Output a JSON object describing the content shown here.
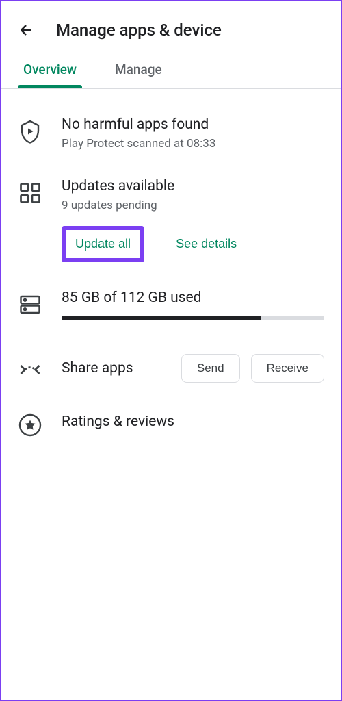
{
  "header": {
    "title": "Manage apps & device"
  },
  "tabs": {
    "overview": "Overview",
    "manage": "Manage"
  },
  "protect": {
    "title": "No harmful apps found",
    "subtitle": "Play Protect scanned at 08:33"
  },
  "updates": {
    "title": "Updates available",
    "subtitle": "9 updates pending",
    "update_all": "Update all",
    "see_details": "See details"
  },
  "storage": {
    "title": "85 GB of 112 GB used",
    "percent": 76
  },
  "share": {
    "title": "Share apps",
    "send": "Send",
    "receive": "Receive"
  },
  "ratings": {
    "title": "Ratings & reviews"
  }
}
